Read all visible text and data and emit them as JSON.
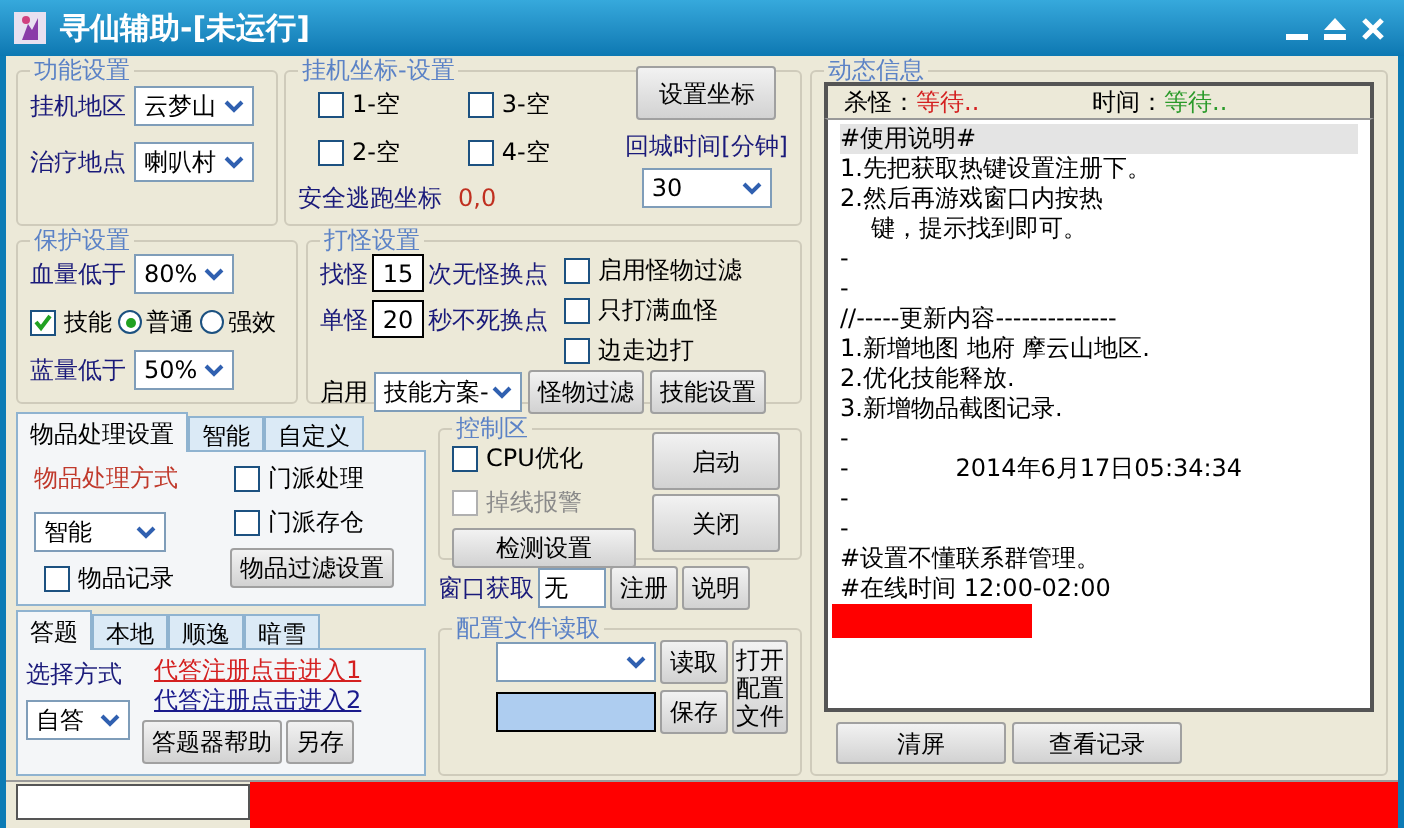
{
  "window": {
    "title": "寻仙辅助-[未运行]"
  },
  "function_settings": {
    "title": "功能设置",
    "fields": [
      {
        "label": "挂机地区",
        "value": "云梦山"
      },
      {
        "label": "治疗地点",
        "value": "喇叭村"
      }
    ]
  },
  "hangup_coords": {
    "title": "挂机坐标-设置",
    "checkboxes": [
      {
        "label": "1-空",
        "checked": false
      },
      {
        "label": "3-空",
        "checked": false
      },
      {
        "label": "2-空",
        "checked": false
      },
      {
        "label": "4-空",
        "checked": false
      }
    ],
    "button": "设置坐标",
    "safe_escape": {
      "label": "安全逃跑坐标",
      "value": "0,0"
    },
    "return_time": {
      "label": "回城时间[分钟]",
      "value": "30"
    }
  },
  "protection": {
    "title": "保护设置",
    "hp": {
      "label": "血量低于",
      "value": "80%"
    },
    "skill": {
      "label": "技能",
      "checked": true
    },
    "radios": [
      {
        "label": "普通",
        "selected": true
      },
      {
        "label": "强效",
        "selected": false
      }
    ],
    "mp": {
      "label": "蓝量低于",
      "value": "50%"
    }
  },
  "combat": {
    "title": "打怪设置",
    "rows": [
      {
        "label": "找怪",
        "value": "15",
        "suffix": "次无怪换点"
      },
      {
        "label": "单怪",
        "value": "20",
        "suffix": "秒不死换点"
      }
    ],
    "checkboxes": [
      {
        "label": "启用怪物过滤",
        "checked": false
      },
      {
        "label": "只打满血怪",
        "checked": false
      },
      {
        "label": "边走边打",
        "checked": false
      }
    ],
    "enable": {
      "label": "启用",
      "value": "技能方案-"
    },
    "buttons": [
      "怪物过滤",
      "技能设置"
    ]
  },
  "item_tabs": {
    "tabs": [
      {
        "label": "物品处理设置",
        "selected": true
      },
      {
        "label": "智能",
        "selected": false
      },
      {
        "label": "自定义",
        "selected": false
      }
    ],
    "method_label": "物品处理方式",
    "method_value": "智能",
    "checkboxes": [
      {
        "label": "门派处理",
        "checked": false
      },
      {
        "label": "门派存仓",
        "checked": false
      }
    ],
    "record": {
      "label": "物品记录",
      "checked": false
    },
    "button": "物品过滤设置"
  },
  "answer_tabs": {
    "tabs": [
      {
        "label": "答题",
        "selected": true
      },
      {
        "label": "本地",
        "selected": false
      },
      {
        "label": "顺逸",
        "selected": false
      },
      {
        "label": "暗雪",
        "selected": false
      }
    ],
    "select_label": "选择方式",
    "select_value": "自答",
    "links": [
      {
        "text": "代答注册点击进入1",
        "color": "#d42020"
      },
      {
        "text": "代答注册点击进入2",
        "color": "#1a1a8c"
      }
    ],
    "buttons": [
      "答题器帮助",
      "另存"
    ]
  },
  "control": {
    "title": "控制区",
    "checkboxes": [
      {
        "label": "CPU优化",
        "checked": false,
        "disabled": false
      },
      {
        "label": "掉线报警",
        "checked": false,
        "disabled": true
      }
    ],
    "buttons": [
      "启动",
      "关闭"
    ],
    "check_button": "检测设置"
  },
  "window_capture": {
    "label": "窗口获取",
    "value": "无",
    "buttons": [
      "注册",
      "说明"
    ]
  },
  "config": {
    "title": "配置文件读取",
    "buttons": [
      "读取",
      "保存"
    ],
    "open_button": "打开配置文件"
  },
  "dynamic": {
    "title": "动态信息",
    "kill": {
      "label": "杀怪：",
      "value": "等待..",
      "color": "#d42020"
    },
    "time": {
      "label": "时间：",
      "value": "等待..",
      "color": "#2a9a2a"
    },
    "lines": [
      {
        "text": "#使用说明#",
        "highlighted": true
      },
      {
        "text": "1.先把获取热键设置注册下。",
        "highlighted": false
      },
      {
        "text": "2.然后再游戏窗口内按热",
        "highlighted": false
      },
      {
        "text": "    键，提示找到即可。",
        "highlighted": false
      },
      {
        "text": "-",
        "highlighted": false
      },
      {
        "text": "-",
        "highlighted": false
      },
      {
        "text": "//-----更新内容--------------",
        "highlighted": false
      },
      {
        "text": "1.新增地图 地府 摩云山地区.",
        "highlighted": false
      },
      {
        "text": "2.优化技能释放.",
        "highlighted": false
      },
      {
        "text": "3.新增物品截图记录.",
        "highlighted": false
      },
      {
        "text": "-",
        "highlighted": false
      },
      {
        "text": "-              2014年6月17日05:34:34",
        "highlighted": false
      },
      {
        "text": "-",
        "highlighted": false
      },
      {
        "text": "-",
        "highlighted": false
      },
      {
        "text": "#设置不懂联系群管理。",
        "highlighted": false
      },
      {
        "text": "#在线时间 12:00-02:00",
        "highlighted": false
      }
    ],
    "buttons": [
      "清屏",
      "查看记录"
    ]
  }
}
